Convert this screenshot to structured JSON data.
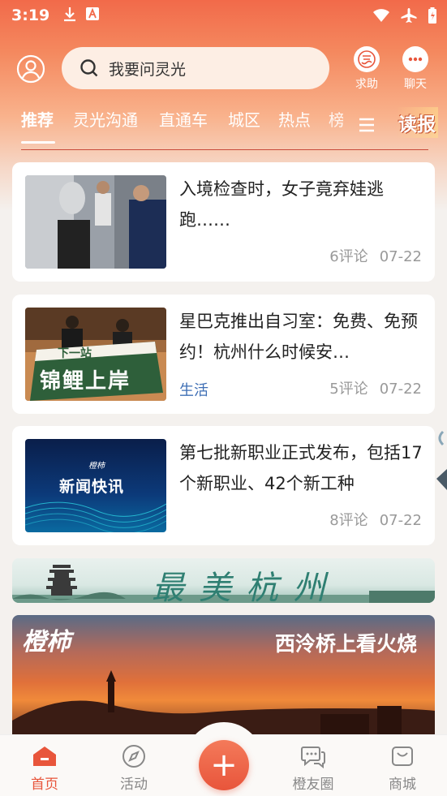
{
  "status_bar": {
    "time": "3:19"
  },
  "header": {
    "search_placeholder": "我要问灵光",
    "help_label": "求助",
    "chat_label": "聊天"
  },
  "tabs": [
    "推荐",
    "灵光沟通",
    "直通车",
    "城区",
    "热点",
    "榜"
  ],
  "dubao_label": "读报",
  "news": [
    {
      "title": "入境检查时，女子竟弃娃逃跑……",
      "tag": "",
      "comments": "6评论",
      "date": "07-22"
    },
    {
      "title": "星巴克推出自习室：免费、免预约！杭州什么时候安…",
      "tag": "生活",
      "comments": "5评论",
      "date": "07-22"
    },
    {
      "title": "第七批新职业正式发布，包括17个新职业、42个新工种",
      "tag": "",
      "comments": "8评论",
      "date": "07-22"
    }
  ],
  "thumb_text": {
    "card2_sign_top": "下一站",
    "card2_sign_main": "锦鲤上岸",
    "card3_logo": "橙柿",
    "card3_label": "新闻快讯"
  },
  "banner": {
    "text": "最美杭州"
  },
  "promo": {
    "logo": "橙柿",
    "title": "西泠桥上看火烧"
  },
  "bottom_nav": {
    "home": "首页",
    "activity": "活动",
    "plus": "+",
    "friends": "橙友圈",
    "mall": "商城"
  },
  "colors": {
    "accent": "#e8553b",
    "tag_blue": "#3f6fb5",
    "header_top": "#f26a4a"
  }
}
